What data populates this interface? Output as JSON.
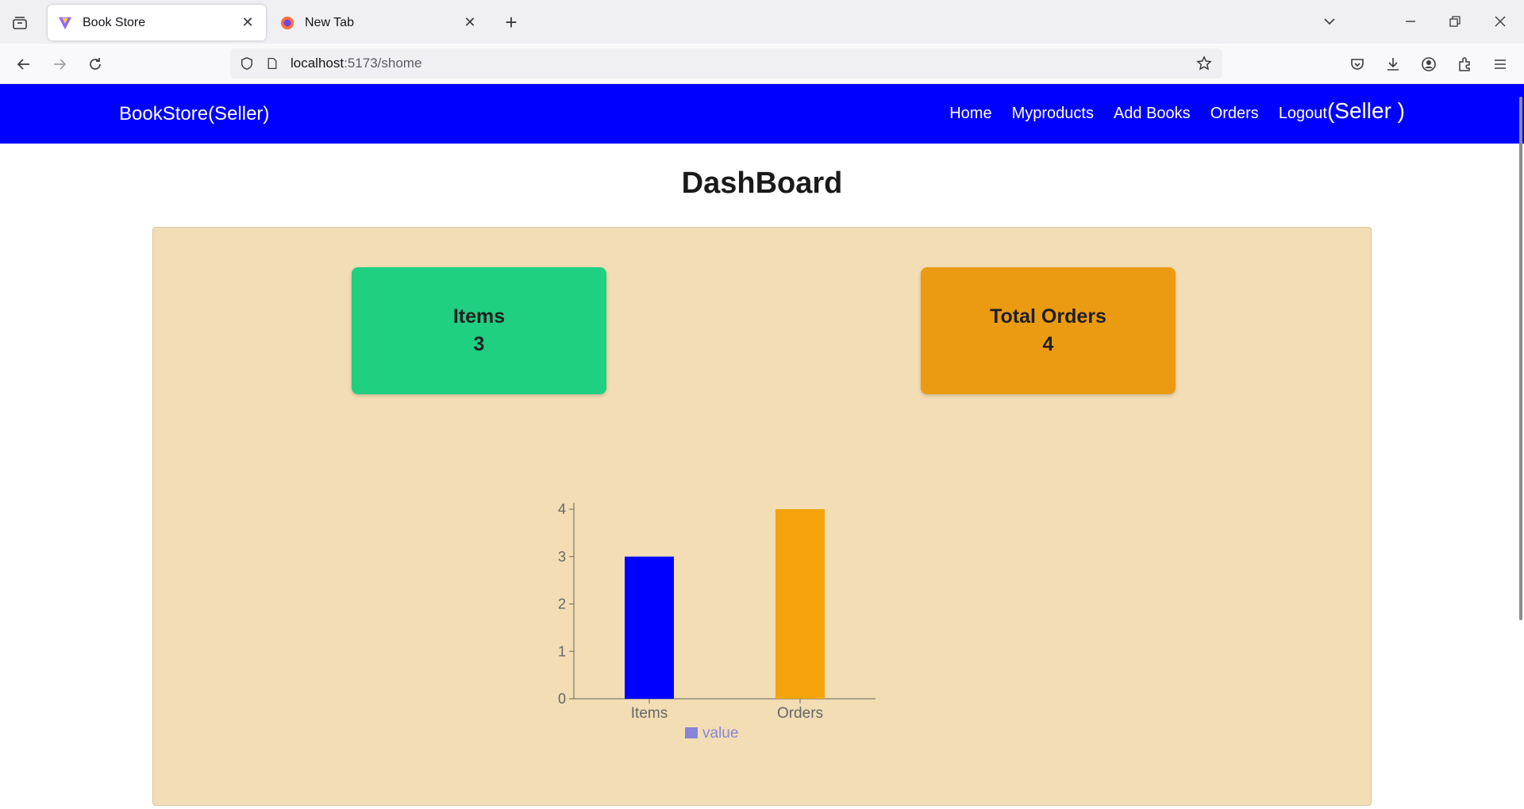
{
  "browser": {
    "tabs": [
      {
        "title": "Book Store",
        "icon": "vite-logo-icon",
        "active": true
      },
      {
        "title": "New Tab",
        "icon": "firefox-logo-icon",
        "active": false
      }
    ],
    "url_host": "localhost",
    "url_path": ":5173/shome"
  },
  "app": {
    "brand": "BookStore(Seller)",
    "nav": {
      "home": "Home",
      "myproducts": "Myproducts",
      "add_books": "Add Books",
      "orders": "Orders",
      "logout": "Logout",
      "role": "(Seller )"
    },
    "colors": {
      "header": "#0000ff",
      "panel": "#f2ddb4",
      "items_card": "#1fcf82",
      "orders_card": "#eb9b12"
    }
  },
  "dashboard": {
    "title": "DashBoard",
    "cards": {
      "items_label": "Items",
      "items_value": "3",
      "orders_label": "Total Orders",
      "orders_value": "4"
    }
  },
  "chart_data": {
    "type": "bar",
    "categories": [
      "Items",
      "Orders"
    ],
    "values": [
      3,
      4
    ],
    "bar_colors": [
      "#0000ff",
      "#f4a40a"
    ],
    "yticks": [
      "0",
      "1",
      "2",
      "3",
      "4"
    ],
    "ylim": [
      0,
      4
    ],
    "legend": "value",
    "legend_color": "#8884d8",
    "legend_position": "bottom"
  }
}
